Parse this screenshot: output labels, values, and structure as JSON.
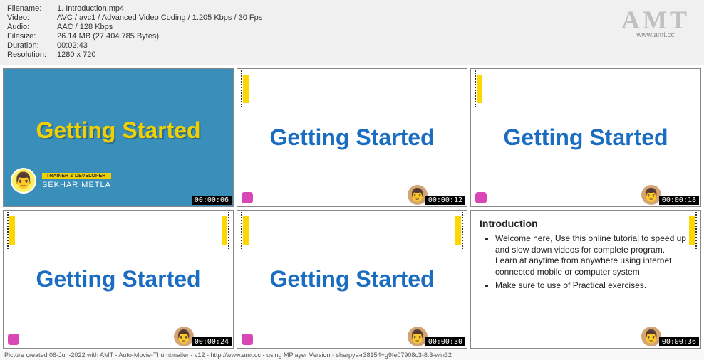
{
  "meta": {
    "labels": {
      "filename": "Filename:",
      "video": "Video:",
      "audio": "Audio:",
      "filesize": "Filesize:",
      "duration": "Duration:",
      "resolution": "Resolution:"
    },
    "values": {
      "filename": "1. Introduction.mp4",
      "video": "AVC / avc1 / Advanced Video Coding / 1.205 Kbps / 30 Fps",
      "audio": "AAC / 128 Kbps",
      "filesize": "26.14 MB (27.404.785 Bytes)",
      "duration": "00:02:43",
      "resolution": "1280 x 720"
    }
  },
  "watermark": {
    "text": "AMT",
    "url": "www.amt.cc"
  },
  "thumbs": {
    "t1": {
      "title": "Getting Started",
      "role": "TRAINER & DEVELOPER",
      "name": "SEKHAR METLA",
      "time": "00:00:06"
    },
    "t2": {
      "title": "Getting Started",
      "time": "00:00:12"
    },
    "t3": {
      "title": "Getting Started",
      "time": "00:00:18"
    },
    "t4": {
      "title": "Getting Started",
      "time": "00:00:24"
    },
    "t5": {
      "title": "Getting Started",
      "time": "00:00:30"
    },
    "t6": {
      "heading": "Introduction",
      "b1": "Welcome here, Use this online tutorial to speed up and slow down videos for complete program.",
      "b1b": "Learn at anytime from anywhere using internet connected mobile or computer system",
      "b2": "Make sure to use of Practical exercises.",
      "time": "00:00:36"
    }
  },
  "footer": "Picture created 06-Jun-2022 with AMT - Auto-Movie-Thumbnailer - v12 - http://www.amt.cc - using MPlayer Version - sherpya-r38154+g9fe07908c3-8.3-win32"
}
